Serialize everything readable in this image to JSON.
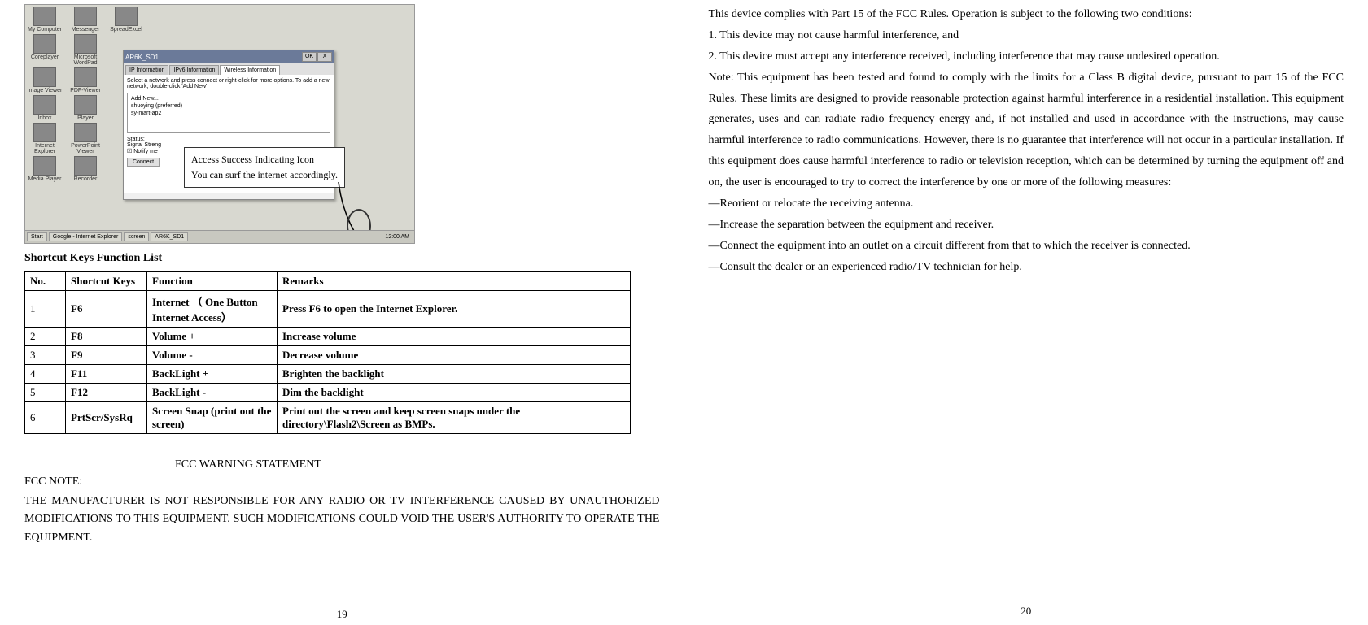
{
  "left_page": {
    "screenshot": {
      "desktop_icons": [
        [
          "My Computer",
          "Messenger",
          "SpreadExcel"
        ],
        [
          "Coreplayer",
          "Microsoft WordPad",
          ""
        ],
        [
          "Image Viewer",
          "PDF-Viewer",
          ""
        ],
        [
          "Inbox",
          "Player",
          ""
        ],
        [
          "Internet Explorer",
          "PowerPoint Viewer",
          ""
        ],
        [
          "Media Player",
          "Recorder",
          ""
        ]
      ],
      "dialog": {
        "title": "AR6K_SD1",
        "ok_btn": "OK",
        "x_btn": "X",
        "tabs": [
          "IP Information",
          "IPv6 Information",
          "Wireless Information"
        ],
        "instruction": "Select a network and press connect or right-click for more options.  To add a new network, double-click 'Add New'.",
        "networks": [
          "Add New...",
          "shuoying (preferred)",
          "sy-mart-ap2"
        ],
        "status_label": "Status:",
        "signal_label": "Signal Streng",
        "notify_label": "Notify me",
        "connect": "Connect"
      },
      "callout": {
        "line1": "Access Success Indicating Icon",
        "line2": "You can surf the internet accordingly."
      },
      "taskbar": {
        "start": "Start",
        "app1": "Google - Internet Explorer",
        "app2": "screen",
        "app3": "AR6K_SD1",
        "time": "12:00 AM"
      }
    },
    "section_title": "Shortcut Keys Function List",
    "table": {
      "headers": [
        "No.",
        "Shortcut Keys",
        "Function",
        "Remarks"
      ],
      "rows": [
        {
          "no": "1",
          "keys": "F6",
          "func": "Internet （ One Button Internet Access）",
          "remarks": "Press F6 to open the Internet Explorer."
        },
        {
          "no": "2",
          "keys": "F8",
          "func": "Volume +",
          "remarks": "Increase volume"
        },
        {
          "no": "3",
          "keys": "F9",
          "func": "Volume -",
          "remarks": "Decrease volume"
        },
        {
          "no": "4",
          "keys": "F11",
          "func": "BackLight +",
          "remarks": "Brighten the backlight"
        },
        {
          "no": "5",
          "keys": "F12",
          "func": "BackLight -",
          "remarks": "Dim the backlight"
        },
        {
          "no": "6",
          "keys": "PrtScr/SysRq",
          "func": "Screen Snap (print out the screen)",
          "remarks": "Print out the screen and keep screen snaps under the directory\\Flash2\\Screen as BMPs."
        }
      ]
    },
    "fcc_title": "FCC WARNING STATEMENT",
    "fcc_note": "FCC NOTE:",
    "fcc_body": "THE MANUFACTURER IS NOT RESPONSIBLE FOR ANY RADIO OR TV INTERFERENCE CAUSED BY UNAUTHORIZED MODIFICATIONS TO THIS EQUIPMENT. SUCH MODIFICATIONS COULD VOID THE USER'S AUTHORITY TO OPERATE THE EQUIPMENT.",
    "page_no": "19"
  },
  "right_page": {
    "intro": "This device complies with Part 15 of the FCC Rules. Operation is subject to the following two conditions:",
    "cond1": "1. This device may not cause harmful interference, and",
    "cond2": "2. This device must accept any interference received, including interference that may cause undesired operation.",
    "note": "Note: This equipment has been tested and found to comply with the limits for a Class B digital device, pursuant to part 15 of the FCC Rules. These limits are designed to provide reasonable protection against harmful interference in a residential installation. This equipment generates, uses and can radiate radio frequency energy and, if not installed and used in accordance with the instructions, may cause harmful interference to radio communications. However, there is no guarantee that interference will not occur in a particular installation. If this equipment does cause harmful interference to radio or television reception, which can be determined by turning the equipment off and on, the user is encouraged to try to correct the interference by one or more of the following measures:",
    "m1": "—Reorient or relocate the receiving antenna.",
    "m2": "—Increase the separation between the equipment and receiver.",
    "m3": "—Connect the equipment into an outlet on a circuit different from that to which the receiver is connected.",
    "m4": "—Consult the dealer or an experienced radio/TV technician for help.",
    "page_no": "20"
  }
}
